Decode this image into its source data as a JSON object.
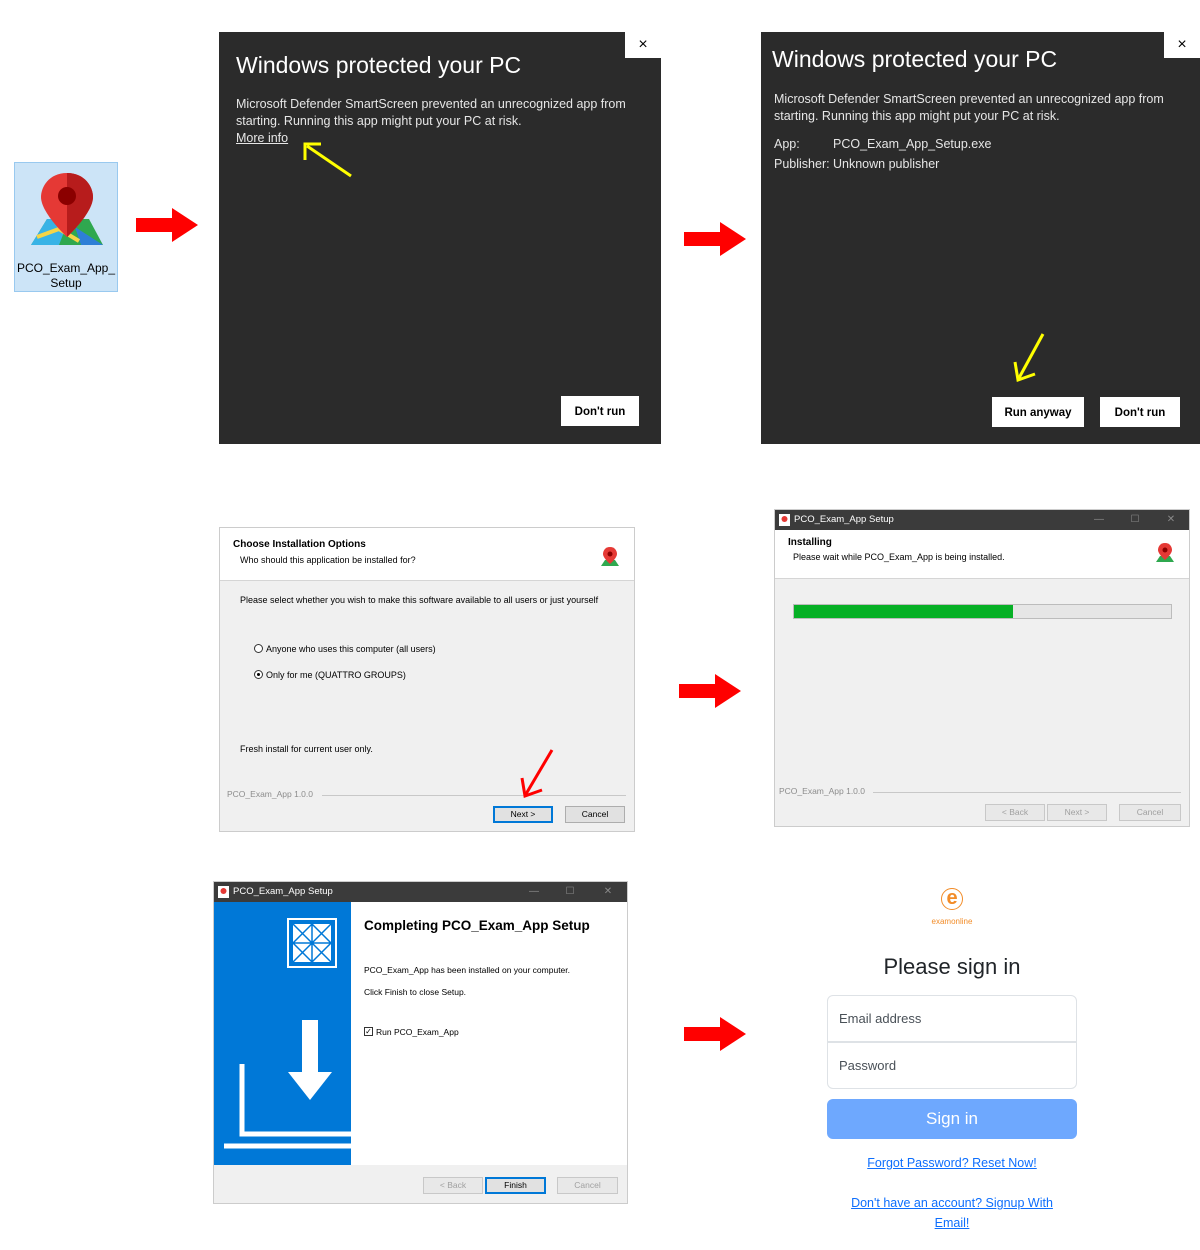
{
  "desktop_icon": {
    "label": "PCO_Exam_App_\nSetup"
  },
  "smartscreen_1": {
    "title": "Windows protected your PC",
    "message": "Microsoft Defender SmartScreen prevented an unrecognized app from starting. Running this app might put your PC at risk.",
    "more_info_link": "More info",
    "dont_run_button": "Don't run",
    "close_glyph": "×"
  },
  "smartscreen_2": {
    "title": "Windows protected your PC",
    "message": "Microsoft Defender SmartScreen prevented an unrecognized app from starting. Running this app might put your PC at risk.",
    "app_label": "App:",
    "app_value": "PCO_Exam_App_Setup.exe",
    "publisher_label": "Publisher:",
    "publisher_value": "Unknown publisher",
    "run_anyway_button": "Run anyway",
    "dont_run_button": "Don't run",
    "close_glyph": "×"
  },
  "install_options": {
    "heading": "Choose Installation Options",
    "subheading": "Who should this application be installed for?",
    "prompt": "Please select whether you wish to make this software available to all users or just yourself",
    "option_all": "Anyone who uses this computer (all users)",
    "option_me": "Only for me (QUATTRO GROUPS)",
    "selected": "Only for me (QUATTRO GROUPS)",
    "status": "Fresh install for current user only.",
    "version": "PCO_Exam_App 1.0.0",
    "next_button": "Next >",
    "cancel_button": "Cancel"
  },
  "installing": {
    "window_title": "PCO_Exam_App Setup",
    "heading": "Installing",
    "subheading": "Please wait while PCO_Exam_App is being installed.",
    "progress": 0.58,
    "version": "PCO_Exam_App 1.0.0",
    "back_button": "< Back",
    "next_button": "Next >",
    "cancel_button": "Cancel"
  },
  "completing": {
    "window_title": "PCO_Exam_App Setup",
    "heading": "Completing PCO_Exam_App Setup",
    "line1": "PCO_Exam_App has been installed on your computer.",
    "line2": "Click Finish to close Setup.",
    "run_checkbox": "Run PCO_Exam_App",
    "back_button": "< Back",
    "finish_button": "Finish",
    "cancel_button": "Cancel"
  },
  "signin": {
    "logo_text": "examonline",
    "title": "Please sign in",
    "email_placeholder": "Email address",
    "password_placeholder": "Password",
    "submit": "Sign in",
    "forgot_link": "Forgot Password? Reset Now!",
    "signup_link": "Don't have an account? Signup With Email!"
  },
  "colors": {
    "arrow_red": "#ff0000",
    "pointer_yellow": "#ffff00",
    "dialog_dark": "#2b2b2b",
    "progress_green": "#06b025",
    "installer_blue": "#0078d7",
    "signin_button": "#6ea8fe"
  }
}
